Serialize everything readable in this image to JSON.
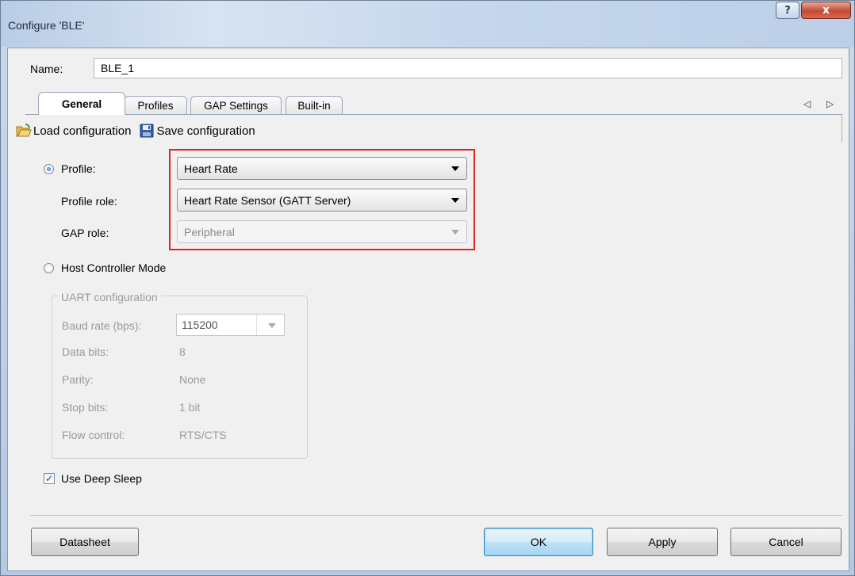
{
  "window": {
    "title": "Configure 'BLE'",
    "help_glyph": "?",
    "close_glyph": "x"
  },
  "name": {
    "label": "Name:",
    "value": "BLE_1"
  },
  "tabs": [
    {
      "label": "General",
      "active": true
    },
    {
      "label": "Profiles",
      "active": false
    },
    {
      "label": "GAP Settings",
      "active": false
    },
    {
      "label": "Built-in",
      "active": false
    }
  ],
  "tab_scroll": "◁ ▷",
  "toolbar": {
    "load_label": "Load configuration",
    "save_label": "Save configuration"
  },
  "profile": {
    "radio_label": "Profile:",
    "selected": true,
    "value": "Heart Rate",
    "role_label": "Profile role:",
    "role_value": "Heart Rate Sensor (GATT Server)",
    "gap_label": "GAP role:",
    "gap_value": "Peripheral"
  },
  "host_mode": {
    "radio_label": "Host Controller Mode",
    "selected": false
  },
  "uart": {
    "title": "UART configuration",
    "baud_label": "Baud rate (bps):",
    "baud_value": "115200",
    "data_bits_label": "Data bits:",
    "data_bits_value": "8",
    "parity_label": "Parity:",
    "parity_value": "None",
    "stop_bits_label": "Stop bits:",
    "stop_bits_value": "1 bit",
    "flow_label": "Flow control:",
    "flow_value": "RTS/CTS"
  },
  "deep_sleep": {
    "label": "Use Deep Sleep",
    "checked": true,
    "check_glyph": "✓"
  },
  "buttons": {
    "datasheet": "Datasheet",
    "ok": "OK",
    "apply": "Apply",
    "cancel": "Cancel"
  },
  "colors": {
    "highlight": "#e32222",
    "accent": "#1e5fb0"
  }
}
